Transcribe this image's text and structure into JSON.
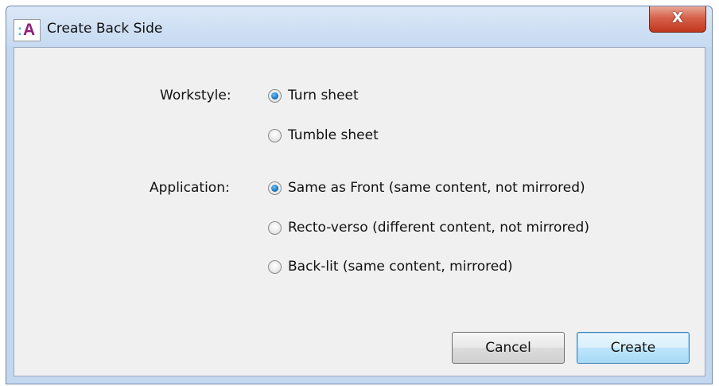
{
  "window": {
    "title": "Create Back Side",
    "close_glyph": "X",
    "app_icon": {
      "name": "app-logo-icon",
      "colon": ":",
      "letter": "A"
    }
  },
  "workstyle": {
    "label": "Workstyle:",
    "options": [
      {
        "label": "Turn sheet",
        "checked": true
      },
      {
        "label": "Tumble sheet",
        "checked": false
      }
    ]
  },
  "application": {
    "label": "Application:",
    "options": [
      {
        "label": "Same as Front (same content, not mirrored)",
        "checked": true
      },
      {
        "label": "Recto-verso (different content, not mirrored)",
        "checked": false
      },
      {
        "label": "Back-lit (same content, mirrored)",
        "checked": false
      }
    ]
  },
  "buttons": {
    "cancel": "Cancel",
    "create": "Create"
  },
  "colors": {
    "accent": "#1f7cc4",
    "close_button": "#c1371d",
    "titlebar": "#c6daf1"
  }
}
